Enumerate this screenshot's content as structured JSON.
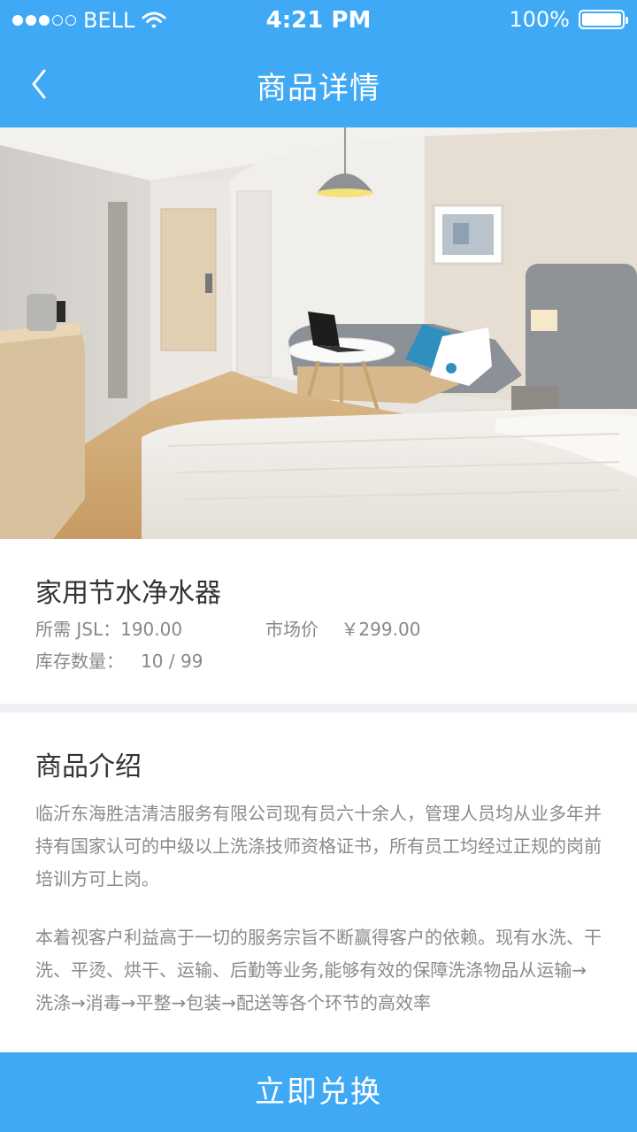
{
  "status_bar": {
    "carrier": "BELL",
    "time": "4:21 PM",
    "battery": "100%",
    "battery_level": 1.0,
    "signal_bars_filled": 3,
    "signal_bars_total": 5
  },
  "nav": {
    "title": "商品详情",
    "back_icon": "chevron-left-icon"
  },
  "hero": {
    "image": "hotel-room-photo"
  },
  "product": {
    "name": "家用节水净水器",
    "price_label": "所需 JSL：190.00",
    "market_label": "市场价",
    "market_price": "￥299.00",
    "stock_label": "库存数量：",
    "stock_value": "10 / 99"
  },
  "intro": {
    "title": "商品介绍",
    "paragraph1": "临沂东海胜洁清洁服务有限公司现有员六十余人，管理人员均从业多年并持有国家认可的中级以上洗涤技师资格证书，所有员工均经过正规的岗前培训方可上岗。",
    "paragraph2": "本着视客户利益高于一切的服务宗旨不断赢得客户的依赖。现有水洗、干洗、平烫、烘干、运输、后勤等业务,能够有效的保障洗涤物品从运输→洗涤→消毒→平整→包装→配送等各个环节的高效率"
  },
  "cta": {
    "label": "立即兑换"
  },
  "colors": {
    "primary": "#3fa9f5",
    "text_dark": "#333333",
    "text_muted": "#888888",
    "divider": "#f0f0f4"
  }
}
